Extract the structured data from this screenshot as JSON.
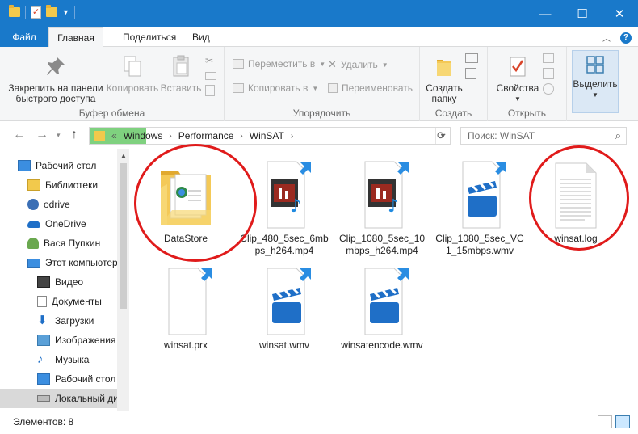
{
  "window": {
    "minimize_icon": "—",
    "maximize_icon": "☐",
    "close_icon": "✕"
  },
  "ribbon_tabs": {
    "file": "Файл",
    "home": "Главная",
    "share": "Поделиться",
    "view": "Вид"
  },
  "ribbon": {
    "pin": "Закрепить на панели быстрого доступа",
    "copy": "Копировать",
    "paste": "Вставить",
    "clipboard_group": "Буфер обмена",
    "move_to": "Переместить в",
    "copy_to": "Копировать в",
    "delete": "Удалить",
    "rename": "Переименовать",
    "organize_group": "Упорядочить",
    "new_folder": "Создать папку",
    "new_group": "Создать",
    "properties": "Свойства",
    "open_group": "Открыть",
    "select": "Выделить"
  },
  "address": {
    "overflow": "«",
    "crumbs": [
      "Windows",
      "Performance",
      "WinSAT"
    ]
  },
  "search": {
    "placeholder": "Поиск: WinSAT"
  },
  "nav_items": [
    {
      "label": "Рабочий стол",
      "icon": "desktop-icon"
    },
    {
      "label": "Библиотеки",
      "icon": "libraries-icon"
    },
    {
      "label": "odrive",
      "icon": "odrive-icon"
    },
    {
      "label": "OneDrive",
      "icon": "onedrive-icon"
    },
    {
      "label": "Вася Пупкин",
      "icon": "user-icon"
    },
    {
      "label": "Этот компьютер",
      "icon": "computer-icon"
    },
    {
      "label": "Видео",
      "icon": "video-icon"
    },
    {
      "label": "Документы",
      "icon": "documents-icon"
    },
    {
      "label": "Загрузки",
      "icon": "downloads-icon"
    },
    {
      "label": "Изображения",
      "icon": "pictures-icon"
    },
    {
      "label": "Музыка",
      "icon": "music-icon"
    },
    {
      "label": "Рабочий стол",
      "icon": "desktop-icon"
    },
    {
      "label": "Локальный ди",
      "icon": "drive-icon"
    }
  ],
  "files": [
    {
      "name": "DataStore",
      "type": "folder"
    },
    {
      "name": "Clip_480_5sec_6mbps_h264.mp4",
      "type": "video-shortcut"
    },
    {
      "name": "Clip_1080_5sec_10mbps_h264.mp4",
      "type": "video-shortcut"
    },
    {
      "name": "Clip_1080_5sec_VC1_15mbps.wmv",
      "type": "clapper-shortcut"
    },
    {
      "name": "winsat.log",
      "type": "text"
    },
    {
      "name": "winsat.prx",
      "type": "blank-shortcut"
    },
    {
      "name": "winsat.wmv",
      "type": "clapper-shortcut"
    },
    {
      "name": "winsatencode.wmv",
      "type": "clapper-shortcut"
    }
  ],
  "status": {
    "count": "Элементов: 8"
  },
  "colors": {
    "titlebar": "#1979ca",
    "annotation_circle": "#e01b1b",
    "address_highlight": "#7fd17f"
  }
}
